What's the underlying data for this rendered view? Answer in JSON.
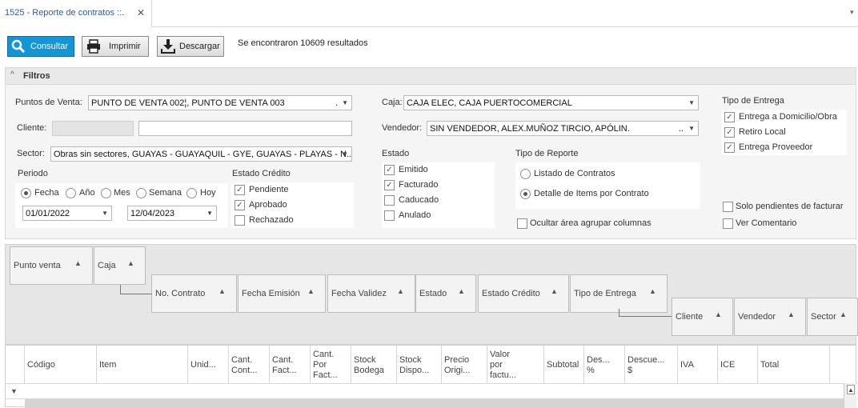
{
  "tab": {
    "title": "1525 - Reporte de contratos ::.",
    "close": "✕",
    "menu": "▾"
  },
  "toolbar": {
    "consultar": "Consultar",
    "imprimir": "Imprimir",
    "descargar": "Descargar",
    "results": "Se encontraron 10609 resultados"
  },
  "filters": {
    "title": "Filtros",
    "collapse": "^",
    "puntos_label": "Puntos de Venta:",
    "puntos_value": "PUNTO DE VENTA 002¦, PUNTO DE VENTA 003",
    "puntos_dots": ".",
    "cliente_label": "Cliente:",
    "cliente_value": "",
    "sector_label": "Sector:",
    "sector_value": "Obras sin sectores, GUAYAS - GUAYAQUIL - GYE, GUAYAS - PLAYAS - N...",
    "caja_label": "Caja:",
    "caja_value": "CAJA ELEC, CAJA PUERTOCOMERCIAL",
    "vendedor_label": "Vendedor:",
    "vendedor_value": "SIN VENDEDOR, ALEX.MUÑOZ TIRCIO, APÓLIN.",
    "vendedor_dots": "..",
    "periodo_label": "Periodo",
    "periodo_options": [
      "Fecha",
      "Año",
      "Mes",
      "Semana",
      "Hoy"
    ],
    "date_from": "01/01/2022",
    "date_to": "12/04/2023",
    "estado_credito_label": "Estado Crédito",
    "estado_credito_options": [
      "Pendiente",
      "Aprobado",
      "Rechazado"
    ],
    "estado_label": "Estado",
    "estado_options": [
      "Emitido",
      "Facturado",
      "Caducado",
      "Anulado"
    ],
    "tipo_reporte_label": "Tipo de Reporte",
    "tipo_reporte_options": [
      "Listado de Contratos",
      "Detalle de Items por Contrato"
    ],
    "ocultar_label": "Ocultar área agrupar columnas",
    "tipo_entrega_label": "Tipo de Entrega",
    "tipo_entrega_options": [
      "Entrega a Domicilio/Obra",
      "Retiro Local",
      "Entrega Proveedor"
    ],
    "solo_pendientes": "Solo pendientes de facturar",
    "ver_comentario": "Ver Comentario"
  },
  "group_headers": [
    "Punto venta",
    "Caja",
    "No. Contrato",
    "Fecha Emisión",
    "Fecha Validez",
    "Estado",
    "Estado Crédito",
    "Tipo de Entrega",
    "Cliente",
    "Vendedor",
    "Sector"
  ],
  "sort_arrow": "▲",
  "columns": [
    [
      "Código"
    ],
    [
      "Item"
    ],
    [
      "Unid..."
    ],
    [
      "Cant.",
      "Cont..."
    ],
    [
      "Cant.",
      "Fact..."
    ],
    [
      "Cant.",
      "Por",
      "Fact..."
    ],
    [
      "Stock",
      "Bodega"
    ],
    [
      "Stock",
      "Dispo..."
    ],
    [
      "Precio",
      "Origi..."
    ],
    [
      "Valor",
      "por",
      "factu..."
    ],
    [
      "Subtotal"
    ],
    [
      "Des...",
      "%"
    ],
    [
      "Descue...",
      "$"
    ],
    [
      "IVA"
    ],
    [
      "ICE"
    ],
    [
      "Total"
    ]
  ],
  "filter_icon": "▼",
  "scroll_up": "▲"
}
